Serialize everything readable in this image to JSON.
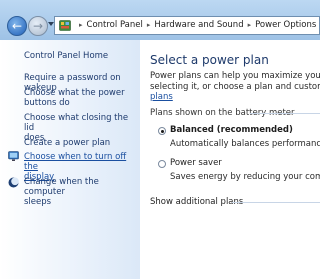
{
  "address_bar": {
    "crumbs": [
      "Control Panel",
      "Hardware and Sound",
      "Power Options"
    ]
  },
  "sidebar": {
    "home_link": "Control Panel Home",
    "links": [
      {
        "label_lines": [
          "Require a password on wakeup"
        ]
      },
      {
        "label_lines": [
          "Choose what the power",
          "buttons do"
        ]
      },
      {
        "label_lines": [
          "Choose what closing the lid",
          "does"
        ]
      },
      {
        "label_lines": [
          "Create a power plan"
        ]
      },
      {
        "label_lines": [
          "Choose when to turn off the",
          "display"
        ]
      },
      {
        "label_lines": [
          "Change when the computer",
          "sleeps"
        ]
      }
    ]
  },
  "main": {
    "title": "Select a power plan",
    "intro_lines": [
      "Power plans can help you maximize your compute",
      "selecting it, or choose a plan and customize it by c",
      "plans"
    ],
    "group_label": "Plans shown on the battery meter",
    "plans": [
      {
        "name": "Balanced (recommended)",
        "description": "Automatically balances performance with en",
        "selected": true
      },
      {
        "name": "Power saver",
        "description": "Saves energy by reducing your computer's p",
        "selected": false
      }
    ],
    "show_additional": "Show additional plans"
  },
  "colors": {
    "link": "#1a4fa0",
    "heading": "#1e3a6b",
    "titlebar": "#a9cbed"
  }
}
